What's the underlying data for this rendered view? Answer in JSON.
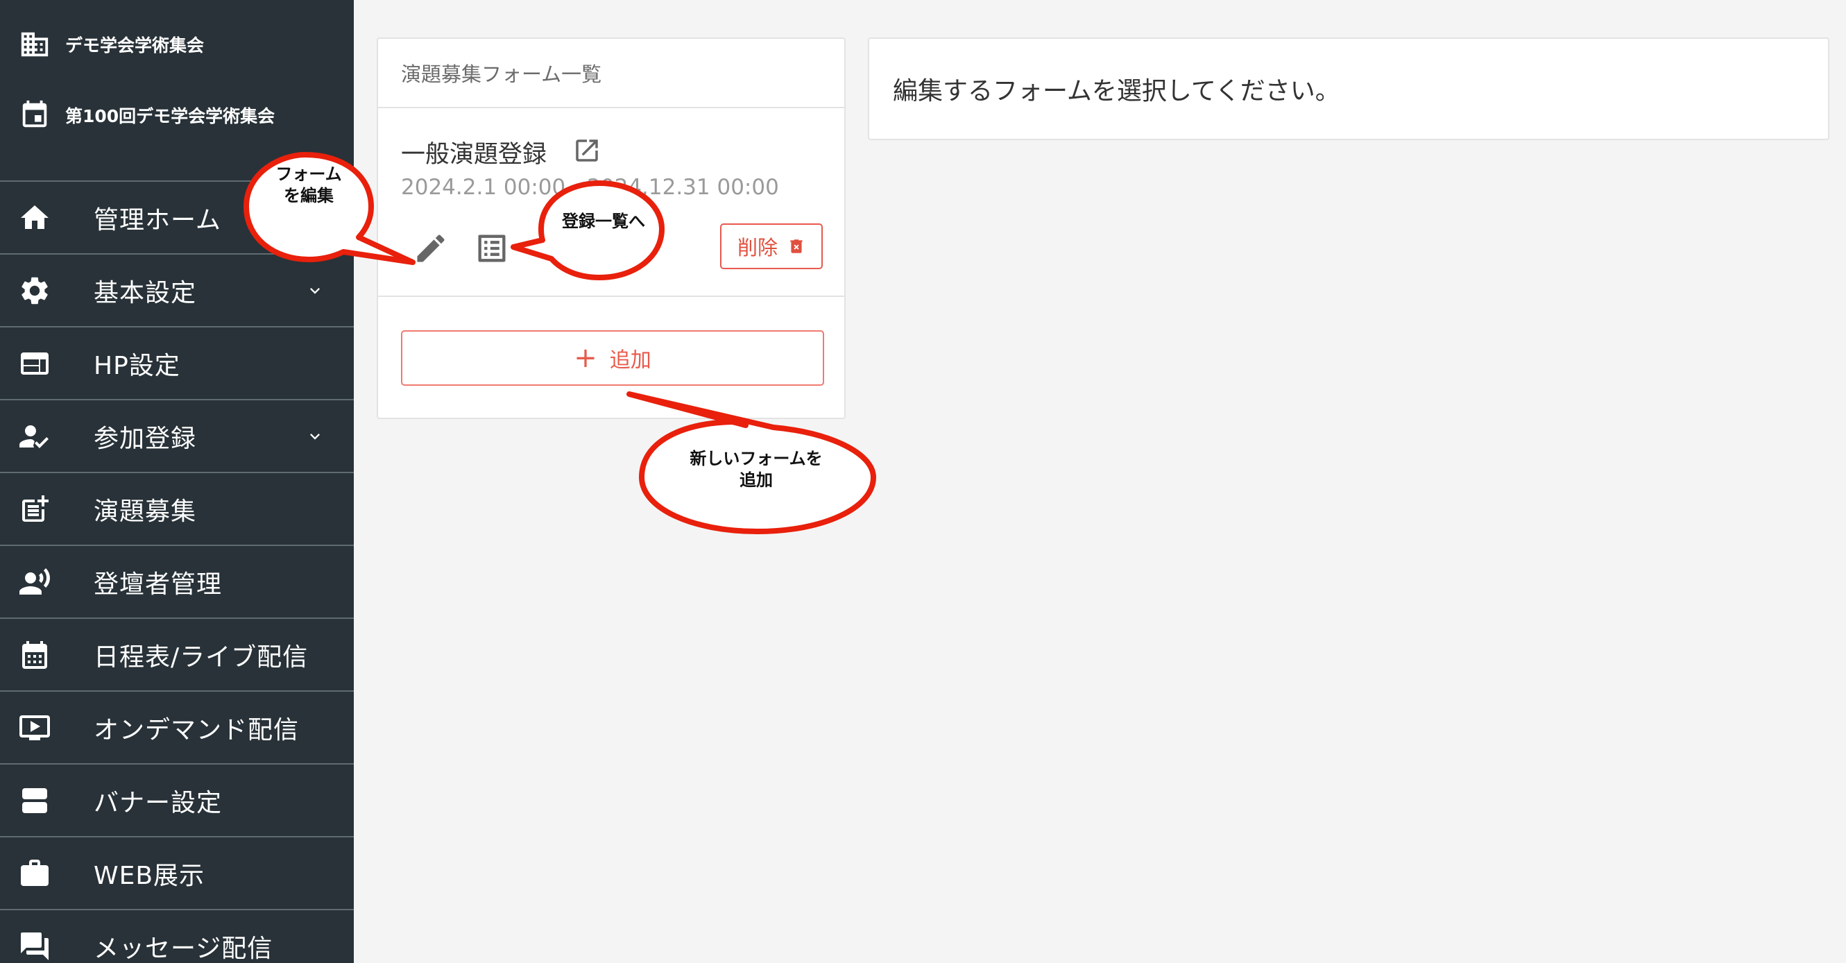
{
  "sidebar": {
    "org_name": "デモ学会学術集会",
    "event_name": "第100回デモ学会学術集会",
    "items": [
      {
        "label": "管理ホーム",
        "icon": "home-icon",
        "has_chevron": false
      },
      {
        "label": "基本設定",
        "icon": "gear-icon",
        "has_chevron": true
      },
      {
        "label": "HP設定",
        "icon": "web-layout-icon",
        "has_chevron": false
      },
      {
        "label": "参加登録",
        "icon": "person-check-icon",
        "has_chevron": true
      },
      {
        "label": "演題募集",
        "icon": "post-add-icon",
        "has_chevron": false
      },
      {
        "label": "登壇者管理",
        "icon": "speaker-group-icon",
        "has_chevron": false
      },
      {
        "label": "日程表/ライブ配信",
        "icon": "calendar-icon",
        "has_chevron": false
      },
      {
        "label": "オンデマンド配信",
        "icon": "video-play-icon",
        "has_chevron": false
      },
      {
        "label": "バナー設定",
        "icon": "banner-icon",
        "has_chevron": false
      },
      {
        "label": "WEB展示",
        "icon": "briefcase-icon",
        "has_chevron": false
      },
      {
        "label": "メッセージ配信",
        "icon": "message-icon",
        "has_chevron": false
      }
    ]
  },
  "form_list": {
    "header": "演題募集フォーム一覧",
    "items": [
      {
        "title": "一般演題登録",
        "dates": "2024.2.1 00:00 - 2024.12.31 00:00",
        "delete_label": "削除"
      }
    ],
    "add_label": "追加"
  },
  "editor": {
    "message": "編集するフォームを選択してください。"
  },
  "annotations": {
    "edit_form": "フォーム\nを編集",
    "to_list": "登録一覧へ",
    "add_new": "新しいフォームを\n追加"
  },
  "colors": {
    "sidebar_bg": "#283238",
    "accent_red": "#e85a4b",
    "callout_red": "#e8200c"
  }
}
